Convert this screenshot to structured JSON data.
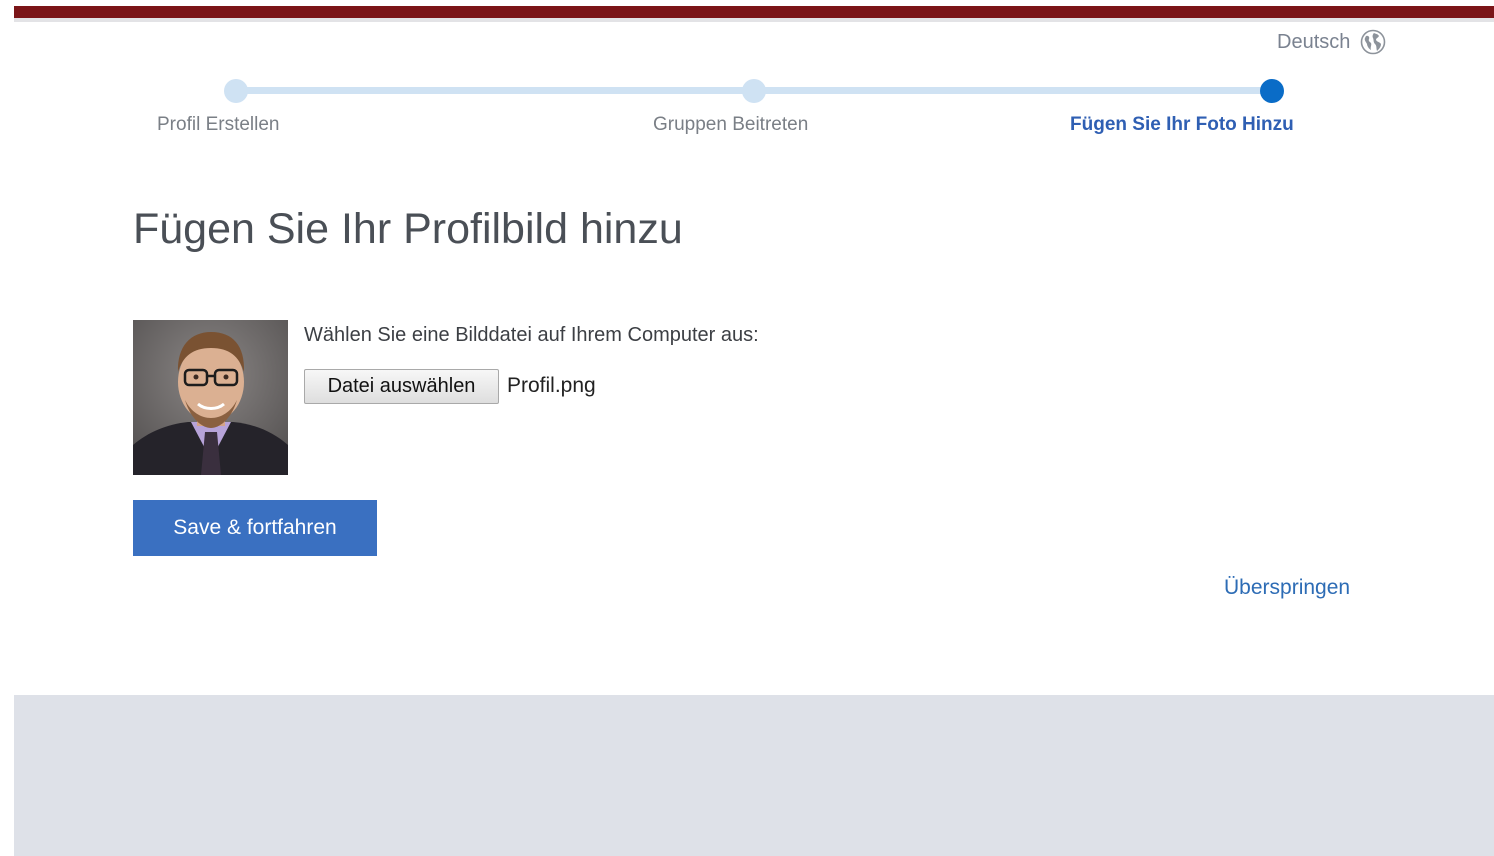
{
  "header": {
    "language_label": "Deutsch",
    "language_icon": "globe-icon",
    "brand_color": "#7b1518"
  },
  "steps": [
    {
      "label": "Profil Erstellen",
      "state": "done"
    },
    {
      "label": "Gruppen Beitreten",
      "state": "done"
    },
    {
      "label": "Fügen Sie Ihr Foto Hinzu",
      "state": "active"
    }
  ],
  "main": {
    "title": "Fügen Sie Ihr Profilbild hinzu",
    "instruction": "Wählen Sie eine Bilddatei auf Ihrem Computer aus:",
    "file_button_label": "Datei auswählen",
    "file_name": "Profil.png",
    "save_button_label": "Save & fortfahren",
    "skip_link_label": "Überspringen"
  },
  "colors": {
    "accent": "#3a70c1",
    "step_active": "#0a6cc7",
    "step_inactive": "#cfe2f3",
    "link": "#2d6cb5",
    "footer": "#dee1e8"
  }
}
